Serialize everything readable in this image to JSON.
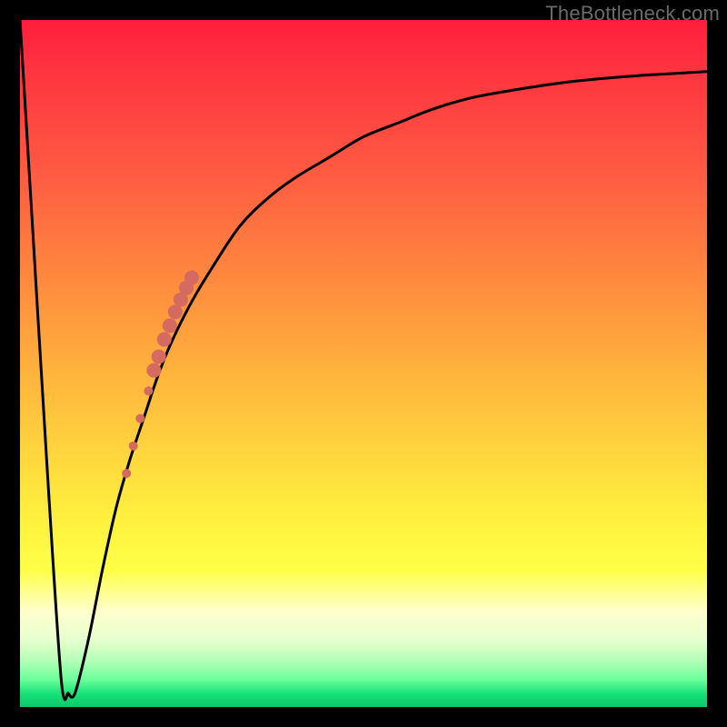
{
  "watermark": "TheBottleneck.com",
  "colors": {
    "background": "#000000",
    "curve": "#000000",
    "dot": "#d46a60",
    "gradient_top": "#ff1e3c",
    "gradient_bottom": "#0cc86a"
  },
  "chart_data": {
    "type": "line",
    "title": "",
    "xlabel": "",
    "ylabel": "",
    "xlim": [
      0,
      100
    ],
    "ylim": [
      0,
      100
    ],
    "grid": false,
    "legend": false,
    "annotations": [
      {
        "text": "TheBottleneck.com",
        "position": "top-right"
      }
    ],
    "series": [
      {
        "name": "bottleneck-curve",
        "x": [
          0,
          2,
          4,
          6,
          7,
          8,
          10,
          12,
          14,
          16,
          18,
          20,
          22,
          25,
          28,
          32,
          36,
          40,
          45,
          50,
          55,
          60,
          65,
          70,
          75,
          80,
          85,
          90,
          95,
          100
        ],
        "values": [
          100,
          67,
          34,
          4,
          2,
          2,
          10,
          20,
          29,
          36,
          42,
          48,
          53,
          59,
          64,
          70,
          74,
          77,
          80,
          83,
          85,
          87,
          88.5,
          89.5,
          90.3,
          91,
          91.5,
          91.9,
          92.2,
          92.5
        ]
      }
    ],
    "markers": {
      "name": "highlighted-points",
      "color": "#d46a60",
      "points": [
        {
          "x": 15.5,
          "y": 34,
          "r": 5
        },
        {
          "x": 16.5,
          "y": 38,
          "r": 5
        },
        {
          "x": 17.5,
          "y": 42,
          "r": 5
        },
        {
          "x": 18.7,
          "y": 46,
          "r": 5
        },
        {
          "x": 19.5,
          "y": 49,
          "r": 8
        },
        {
          "x": 20.2,
          "y": 51,
          "r": 8
        },
        {
          "x": 21.0,
          "y": 53.5,
          "r": 8
        },
        {
          "x": 21.8,
          "y": 55.5,
          "r": 8
        },
        {
          "x": 22.6,
          "y": 57.5,
          "r": 8
        },
        {
          "x": 23.4,
          "y": 59.3,
          "r": 8
        },
        {
          "x": 24.2,
          "y": 61.0,
          "r": 8
        },
        {
          "x": 25.0,
          "y": 62.5,
          "r": 8
        }
      ]
    }
  }
}
